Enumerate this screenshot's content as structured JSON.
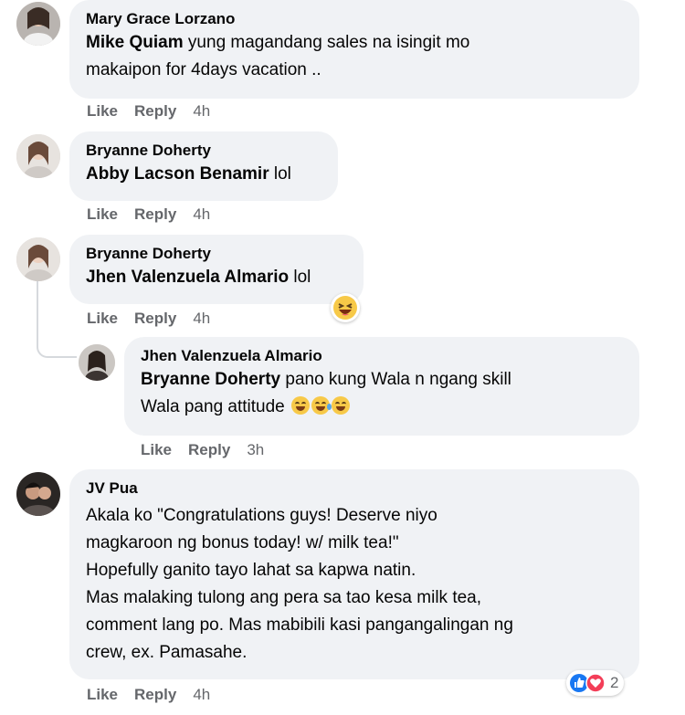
{
  "comments": [
    {
      "author": "Mary Grace Lorzano",
      "mention": "Mike Quiam",
      "text_line1": " yung magandang sales na isingit mo",
      "text_line2": "makaipon for 4days vacation ..",
      "like": "Like",
      "reply": "Reply",
      "time": "4h"
    },
    {
      "author": "Bryanne Doherty",
      "mention": "Abby Lacson Benamir",
      "text": " lol",
      "like": "Like",
      "reply": "Reply",
      "time": "4h"
    },
    {
      "author": "Bryanne Doherty",
      "mention": "Jhen Valenzuela Almario",
      "text": " lol",
      "reaction_icon": "laughing-emoji-icon",
      "like": "Like",
      "reply": "Reply",
      "time": "4h"
    },
    {
      "author": "Jhen Valenzuela Almario",
      "mention": "Bryanne Doherty",
      "text_line1": " pano kung Wala n ngang skill",
      "text_line2": "Wala pang attitude",
      "emojis": [
        "grinning-sweat-emoji-icon",
        "crying-emoji-icon",
        "grinning-sweat-emoji-icon"
      ],
      "like": "Like",
      "reply": "Reply",
      "time": "3h"
    },
    {
      "author": "JV Pua",
      "lines": [
        "Akala ko \"Congratulations guys! Deserve niyo",
        "magkaroon ng bonus today! w/ milk tea!\"",
        "Hopefully ganito tayo lahat sa kapwa natin.",
        "Mas malaking tulong ang pera sa tao kesa milk tea,",
        "comment lang po. Mas mabibili kasi pangangalingan ng",
        "crew, ex. Pamasahe."
      ],
      "reactions": {
        "icons": [
          "like-icon",
          "love-icon"
        ],
        "count": "2"
      },
      "like": "Like",
      "reply": "Reply",
      "time": "4h"
    }
  ],
  "colors": {
    "bubble": "#f0f2f5",
    "meta": "#65676b",
    "like_blue": "#1877f2",
    "love_red": "#f33e58"
  }
}
